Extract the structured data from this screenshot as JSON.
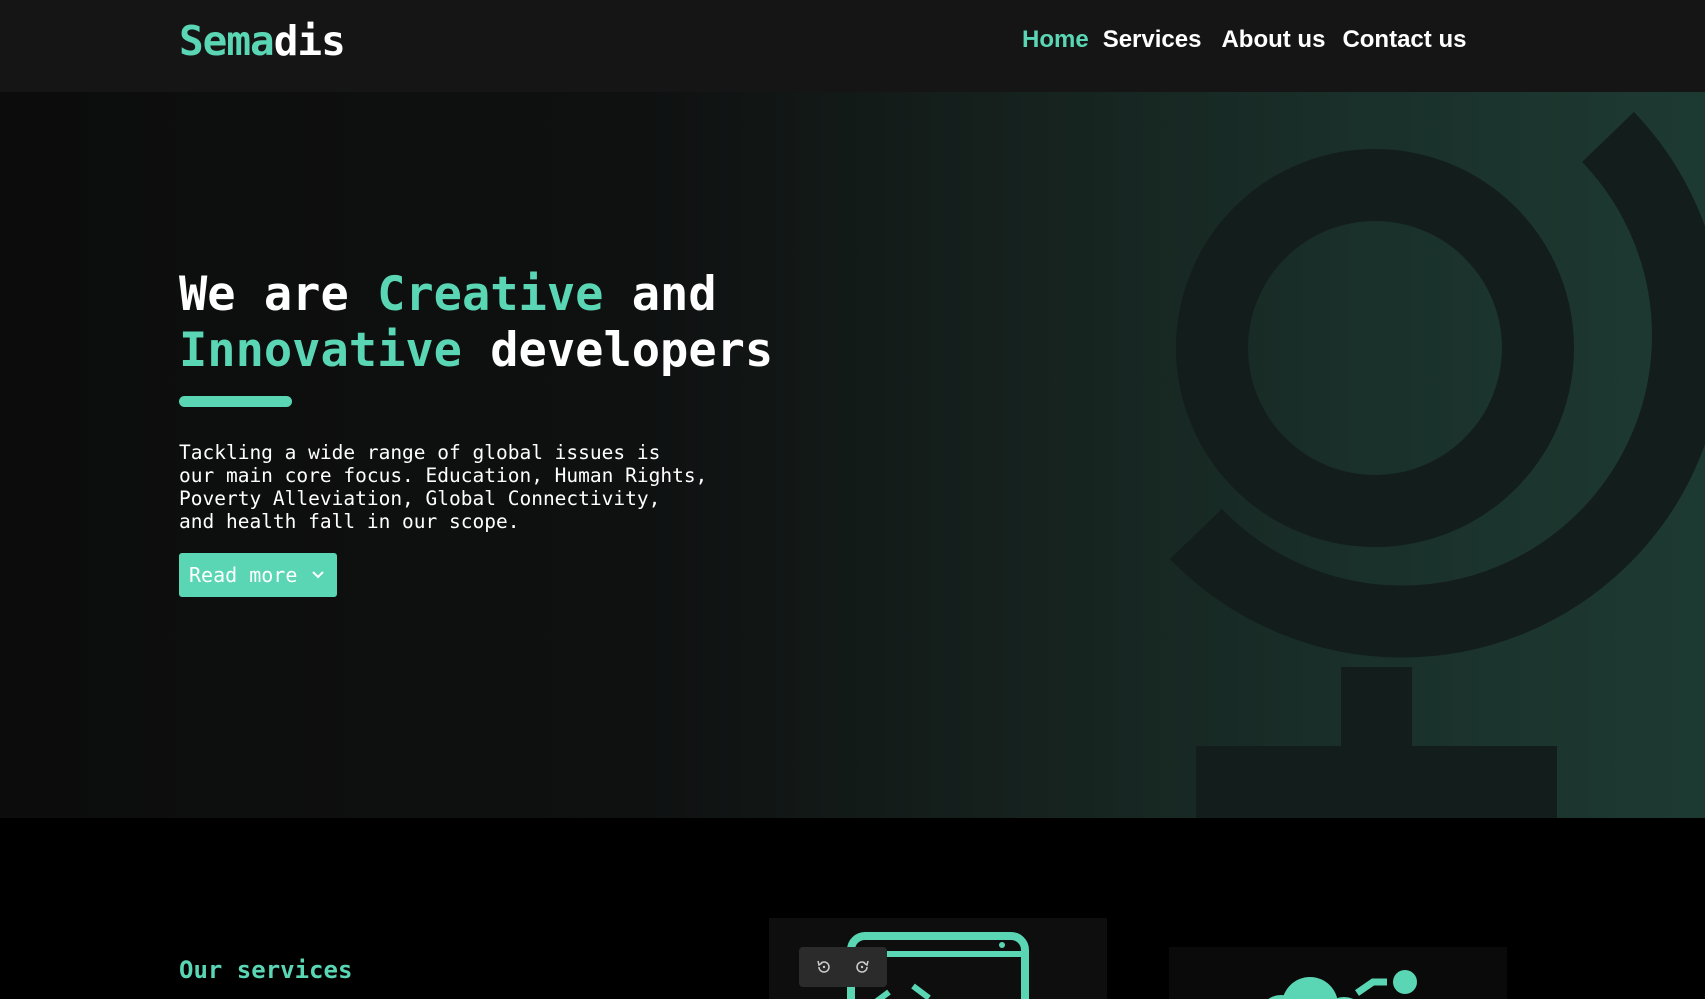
{
  "brand": {
    "name_accent": "Sema",
    "name_rest": "dis",
    "accent_color": "#5ad6b4"
  },
  "nav": {
    "items": [
      {
        "label": "Home",
        "active": true
      },
      {
        "label": "Services",
        "active": false
      },
      {
        "label": "About us",
        "active": false
      },
      {
        "label": "Contact us",
        "active": false
      }
    ]
  },
  "hero": {
    "headline": {
      "part1": "We are ",
      "part2_accent": "Creative",
      "part3": " and",
      "part4_accent": "Innovative",
      "part5": " developers"
    },
    "description_lines": [
      "Tackling a wide range of global issues is",
      "our main core focus. Education, Human Rights,",
      "Poverty Alleviation, Global Connectivity,",
      "and health fall in our scope."
    ],
    "cta_label": "Read more",
    "cta_icon": "chevron-down-icon",
    "art_icon": "globe-icon"
  },
  "services": {
    "title": "Our services",
    "cards": [
      {
        "icon": "code-window-icon"
      },
      {
        "icon": "cloud-network-icon"
      }
    ]
  },
  "history_controls": {
    "back_icon": "undo-icon",
    "forward_icon": "redo-icon"
  }
}
